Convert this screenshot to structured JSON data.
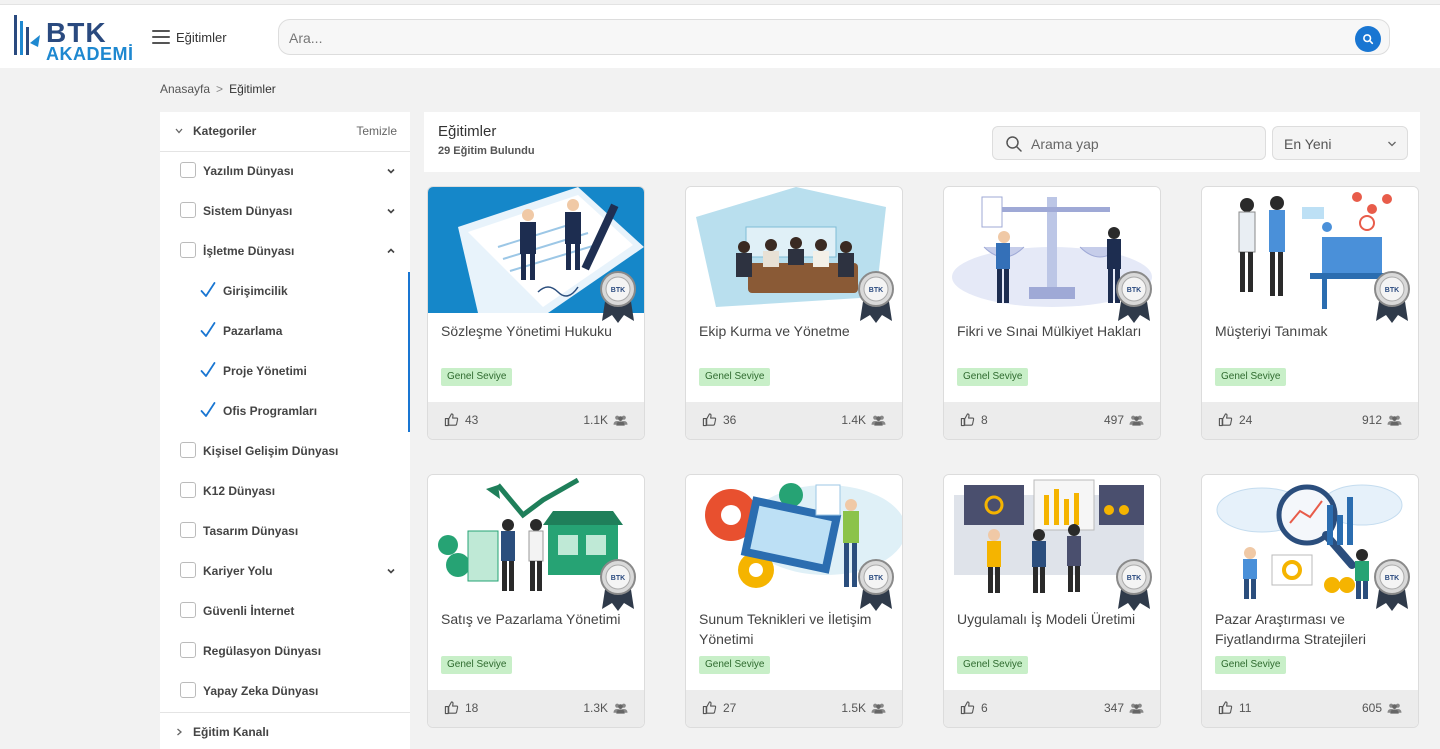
{
  "header": {
    "logo_top": "BTK",
    "logo_bottom": "AKADEMİ",
    "menu_label": "Eğitimler",
    "search_placeholder": "Ara..."
  },
  "breadcrumb": {
    "home": "Anasayfa",
    "separator": ">",
    "current": "Eğitimler"
  },
  "sidebar": {
    "header_title": "Kategoriler",
    "clear_label": "Temizle",
    "categories": [
      {
        "label": "Yazılım Dünyası",
        "checked": false,
        "arrow": "down"
      },
      {
        "label": "Sistem Dünyası",
        "checked": false,
        "arrow": "down"
      },
      {
        "label": "İşletme Dünyası",
        "checked": false,
        "arrow": "up"
      },
      {
        "label": "Kişisel Gelişim Dünyası",
        "checked": false,
        "arrow": ""
      },
      {
        "label": "K12 Dünyası",
        "checked": false,
        "arrow": ""
      },
      {
        "label": "Tasarım Dünyası",
        "checked": false,
        "arrow": ""
      },
      {
        "label": "Kariyer Yolu",
        "checked": false,
        "arrow": "down"
      },
      {
        "label": "Güvenli İnternet",
        "checked": false,
        "arrow": ""
      },
      {
        "label": "Regülasyon Dünyası",
        "checked": false,
        "arrow": ""
      },
      {
        "label": "Yapay Zeka Dünyası",
        "checked": false,
        "arrow": ""
      }
    ],
    "subcategories": [
      {
        "label": "Girişimcilik",
        "checked": true
      },
      {
        "label": "Pazarlama",
        "checked": true
      },
      {
        "label": "Proje Yönetimi",
        "checked": true
      },
      {
        "label": "Ofis Programları",
        "checked": true
      }
    ],
    "channel_title": "Eğitim Kanalı"
  },
  "results": {
    "title": "Eğitimler",
    "count": "29 Eğitim Bulundu",
    "search_placeholder": "Arama yap",
    "sort_selected": "En Yeni"
  },
  "badge_text": "BTK",
  "cards": [
    {
      "title": "Sözleşme Yönetimi Hukuku",
      "level": "Genel Seviye",
      "likes": "43",
      "views": "1.1K",
      "theme": "contract"
    },
    {
      "title": "Ekip Kurma ve Yönetme",
      "level": "Genel Seviye",
      "likes": "36",
      "views": "1.4K",
      "theme": "team"
    },
    {
      "title": "Fikri ve Sınai Mülkiyet Hakları",
      "level": "Genel Seviye",
      "likes": "8",
      "views": "497",
      "theme": "law"
    },
    {
      "title": "Müşteriyi Tanımak",
      "level": "Genel Seviye",
      "likes": "24",
      "views": "912",
      "theme": "customer"
    },
    {
      "title": "Satış ve Pazarlama Yönetimi",
      "level": "Genel Seviye",
      "likes": "18",
      "views": "1.3K",
      "theme": "sales"
    },
    {
      "title": "Sunum Teknikleri ve İletişim Yönetimi",
      "level": "Genel Seviye",
      "likes": "27",
      "views": "1.5K",
      "theme": "presentation"
    },
    {
      "title": "Uygulamalı İş Modeli Üretimi",
      "level": "Genel Seviye",
      "likes": "6",
      "views": "347",
      "theme": "business"
    },
    {
      "title": "Pazar Araştırması ve Fiyatlandırma Stratejileri",
      "level": "Genel Seviye",
      "likes": "11",
      "views": "605",
      "theme": "research"
    }
  ],
  "colors": {
    "accent": "#1976d2",
    "level_bg": "#c8efc8",
    "level_text": "#2f6b2f",
    "logo_dark": "#2a4a7f",
    "logo_light": "#1e88d0"
  }
}
